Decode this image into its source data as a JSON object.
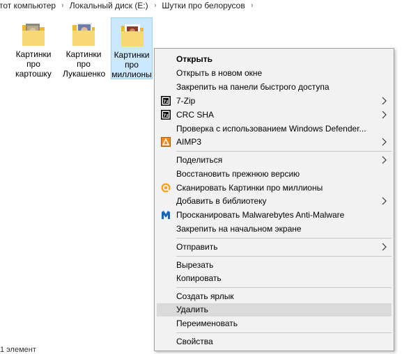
{
  "breadcrumb": {
    "items": [
      "тот компьютер",
      "Локальный диск (E:)",
      "Шутки про белорусов"
    ],
    "separator": "›"
  },
  "files": [
    {
      "line1": "Картинки",
      "line2": "про",
      "line3": "картошку"
    },
    {
      "line1": "Картинки",
      "line2": "про",
      "line3": "Лукашенко"
    },
    {
      "line1": "Картинки",
      "line2": "про",
      "line3": "миллионы"
    }
  ],
  "menu": {
    "open": "Открыть",
    "open_new_window": "Открыть в новом окне",
    "pin_quick_access": "Закрепить на панели быстрого доступа",
    "zip": "7-Zip",
    "crc": "CRC SHA",
    "defender": "Проверка с использованием Windows Defender...",
    "aimp": "AIMP3",
    "share": "Поделиться",
    "restore": "Восстановить прежнюю версию",
    "scan": "Сканировать Картинки про миллионы",
    "add_library": "Добавить в библиотеку",
    "malwarebytes": "Просканировать Malwarebytes Anti-Malware",
    "pin_start": "Закрепить на начальном экране",
    "send_to": "Отправить",
    "cut": "Вырезать",
    "copy": "Копировать",
    "shortcut": "Создать ярлык",
    "delete": "Удалить",
    "rename": "Переименовать",
    "properties": "Свойства"
  },
  "status": {
    "count": "1 элемент"
  },
  "colors": {
    "selection_bg": "#cce8ff",
    "menu_bg": "#f2f2f2",
    "hover_bg": "#dadada",
    "folder_yellow": "#f8d775"
  }
}
